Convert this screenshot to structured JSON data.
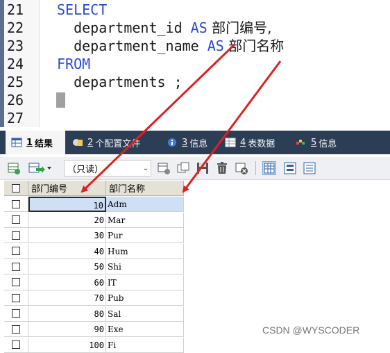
{
  "editor": {
    "lines": [
      {
        "num": "21",
        "kw": "SELECT",
        "text": ""
      },
      {
        "num": "22",
        "pre": "  department_id ",
        "kw": "AS",
        "post": " 部门编号,"
      },
      {
        "num": "23",
        "pre": "  department_name ",
        "kw": "AS",
        "post": " 部门名称"
      },
      {
        "num": "24",
        "kw": "FROM",
        "text": ""
      },
      {
        "num": "25",
        "text": "  departments ;"
      },
      {
        "num": "26",
        "text": ""
      },
      {
        "num": "27",
        "text": ""
      }
    ]
  },
  "tabs": [
    {
      "num": "1",
      "label": "结果",
      "icon": "result-grid-icon",
      "active": true
    },
    {
      "num": "2",
      "label": "个配置文件",
      "icon": "profile-icon"
    },
    {
      "num": "3",
      "label": "信息",
      "icon": "info-icon"
    },
    {
      "num": "4",
      "label": "表数据",
      "icon": "table-data-icon"
    },
    {
      "num": "5",
      "label": "信息",
      "icon": "info-icon"
    }
  ],
  "toolbar": {
    "mode_select": "（只读）"
  },
  "grid": {
    "columns": [
      "部门编号",
      "部门名称"
    ],
    "rows": [
      {
        "id": "10",
        "name": "Adm"
      },
      {
        "id": "20",
        "name": "Mar"
      },
      {
        "id": "30",
        "name": "Pur"
      },
      {
        "id": "40",
        "name": "Hum"
      },
      {
        "id": "50",
        "name": "Shi"
      },
      {
        "id": "60",
        "name": "IT"
      },
      {
        "id": "70",
        "name": "Pub"
      },
      {
        "id": "80",
        "name": "Sal"
      },
      {
        "id": "90",
        "name": "Exe"
      },
      {
        "id": "100",
        "name": "Fi"
      }
    ]
  },
  "watermark": "CSDN @WYSCODER",
  "colors": {
    "keyword": "#2b4bd9",
    "arrow": "#e02020",
    "tabbar": "#2c3e56",
    "header": "#e4e1d6"
  }
}
